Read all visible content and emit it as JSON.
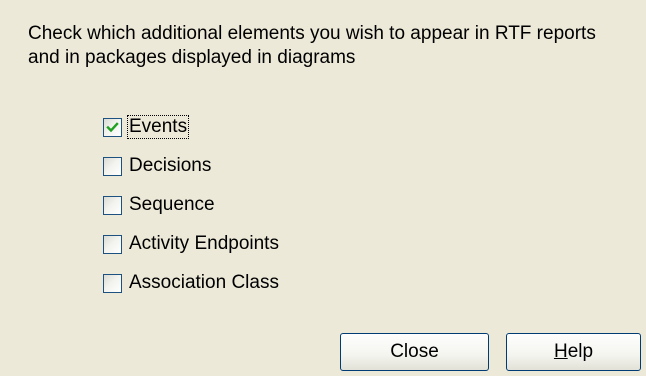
{
  "dialog": {
    "description": "Check which additional elements you wish to appear in RTF reports and in packages displayed in diagrams",
    "options": [
      {
        "label": "Events",
        "checked": true,
        "focused": true
      },
      {
        "label": "Decisions",
        "checked": false,
        "focused": false
      },
      {
        "label": "Sequence",
        "checked": false,
        "focused": false
      },
      {
        "label": "Activity Endpoints",
        "checked": false,
        "focused": false
      },
      {
        "label": "Association Class",
        "checked": false,
        "focused": false
      }
    ],
    "buttons": {
      "close_label": "Close",
      "help_mnemonic": "H",
      "help_rest": "elp"
    }
  },
  "colors": {
    "background": "#ece9d8",
    "checkbox_border": "#1c5180",
    "checkmark": "#21a121",
    "button_border": "#003c74"
  }
}
